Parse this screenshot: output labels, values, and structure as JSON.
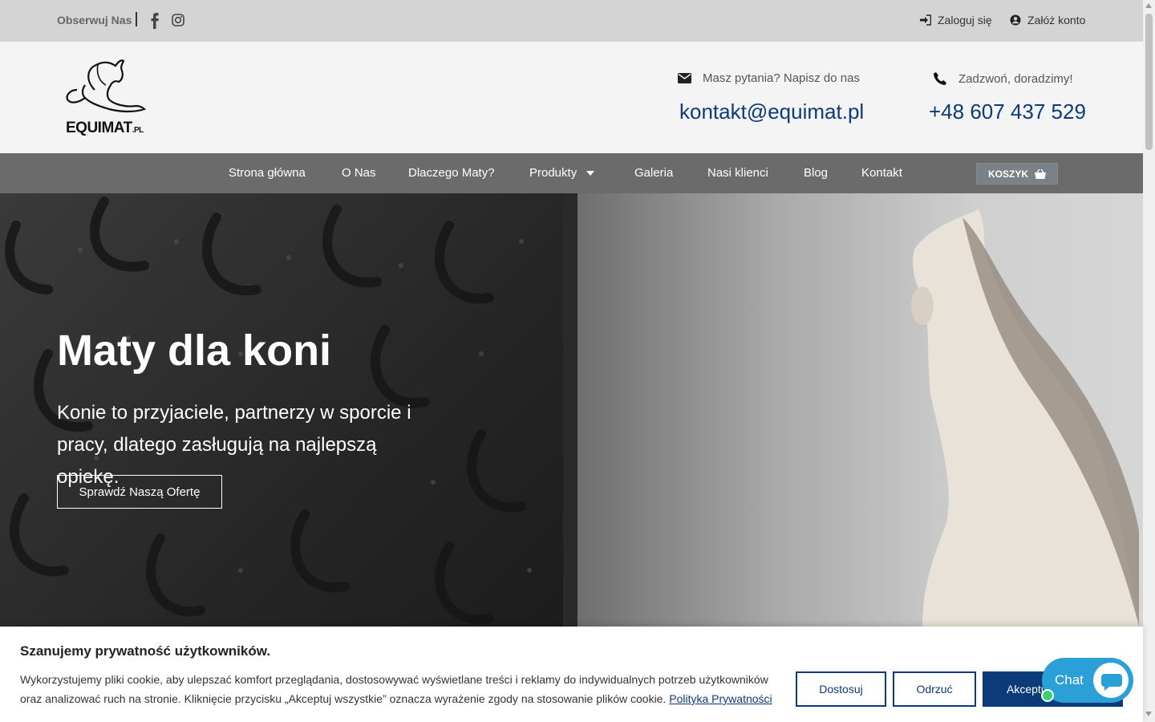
{
  "topbar": {
    "follow_label": "Obserwuj Nas",
    "social": [
      "facebook-icon",
      "instagram-icon"
    ],
    "login_label": "Zaloguj się",
    "register_label": "Załóż konto"
  },
  "header": {
    "logo_text": "EQUIMAT",
    "logo_suffix": ".PL",
    "mail_question": "Masz pytania? Napisz do nas",
    "mail_value": "kontakt@equimat.pl",
    "phone_question": "Zadzwoń, doradzimy!",
    "phone_value": "+48 607 437 529"
  },
  "nav": {
    "items": [
      {
        "label": "Strona główna"
      },
      {
        "label": "O Nas"
      },
      {
        "label": "Dlaczego Maty?"
      },
      {
        "label": "Produkty"
      },
      {
        "label": "Galeria"
      },
      {
        "label": "Nasi klienci"
      },
      {
        "label": "Blog"
      },
      {
        "label": "Kontakt"
      }
    ],
    "cart_label": "KOSZYK"
  },
  "hero": {
    "title": "Maty dla koni",
    "subtitle": "Konie to przyjaciele, partnerzy w sporcie i pracy, dlatego zasługują na najlepszą opiekę.",
    "cta_label": "Sprawdź Naszą Ofertę"
  },
  "cookie": {
    "title": "Szanujemy prywatność użytkowników.",
    "text": "Wykorzystujemy pliki cookie, aby ulepszać komfort przeglądania, dostosowywać wyświetlane treści i reklamy do indywidualnych potrzeb użytkowników oraz analizować ruch na stronie. Kliknięcie przycisku „Akceptuj wszystkie” oznacza wyrażenie zgody na stosowanie plików cookie.",
    "link_label": "Polityka Prywatności",
    "customize_label": "Dostosuj",
    "reject_label": "Odrzuć",
    "accept_label": "Akceptuj"
  },
  "chat": {
    "label": "Chat"
  },
  "colors": {
    "brand": "#0d3b7a",
    "nav_bg": "#6b6b6b",
    "topbar_bg": "#d4d4d4",
    "chat": "#2a9fd8"
  }
}
